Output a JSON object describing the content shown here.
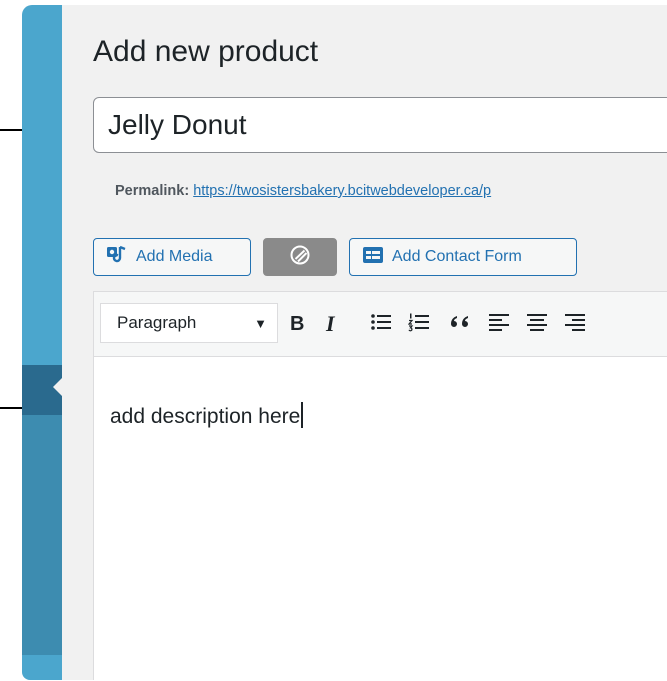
{
  "page": {
    "title": "Add new product"
  },
  "product": {
    "title_value": "Jelly Donut",
    "permalink_label": "Permalink:",
    "permalink_url": "https://twosistersbakery.bcitwebdeveloper.ca/p"
  },
  "media_buttons": {
    "add_media": "Add Media",
    "add_contact_form": "Add Contact Form"
  },
  "toolbar": {
    "format_value": "Paragraph",
    "bold": "B",
    "italic": "I"
  },
  "editor": {
    "content": "add description here"
  },
  "colors": {
    "sidebar": "#4ba6cd",
    "sidebar_active": "#2a6a8e",
    "accent": "#2271b1",
    "background": "#f1f1f1"
  },
  "icons": [
    "add-media-icon",
    "toggle-icon",
    "contact-form-icon",
    "caret-down-icon",
    "bullet-list-icon",
    "numbered-list-icon",
    "blockquote-icon",
    "align-left-icon",
    "align-center-icon",
    "align-right-icon"
  ]
}
